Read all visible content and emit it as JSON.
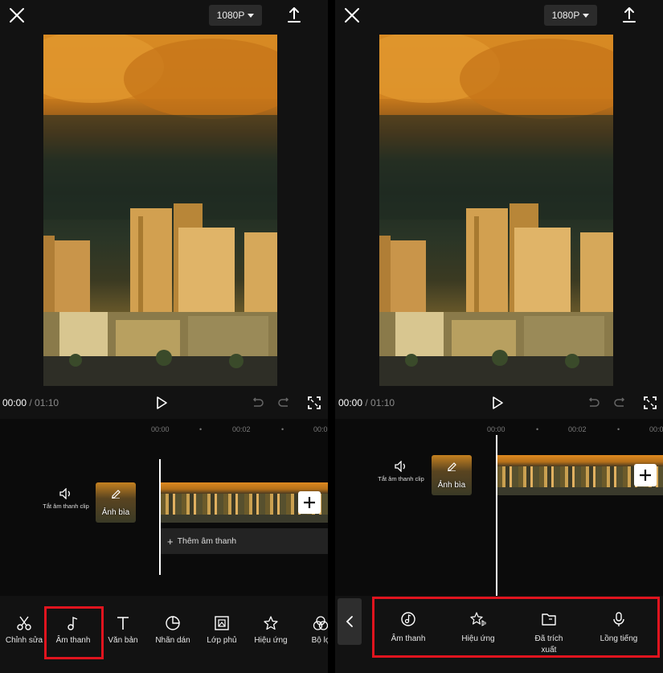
{
  "left": {
    "resolution": "1080P",
    "time_current": "00:00",
    "time_total": "01:10",
    "ruler": [
      "00:00",
      "00:02",
      "00:0"
    ],
    "mute_label": "Tắt âm thanh clip",
    "cover_label": "Ảnh bìa",
    "add_audio_label": "Thêm âm thanh",
    "tools": [
      {
        "label": "Chỉnh sửa",
        "icon": "scissors-icon"
      },
      {
        "label": "Âm thanh",
        "icon": "music-note-icon"
      },
      {
        "label": "Văn bản",
        "icon": "text-icon"
      },
      {
        "label": "Nhãn dán",
        "icon": "sticker-icon"
      },
      {
        "label": "Lớp phủ",
        "icon": "overlay-icon"
      },
      {
        "label": "Hiệu ứng",
        "icon": "effects-star-icon"
      },
      {
        "label": "Bộ lọ",
        "icon": "filter-icon"
      }
    ]
  },
  "right": {
    "resolution": "1080P",
    "time_current": "00:00",
    "time_total": "01:10",
    "ruler": [
      "00:00",
      "00:02",
      "00:0"
    ],
    "mute_label": "Tắt âm thanh clip",
    "cover_label": "Ảnh bìa",
    "subtools": [
      {
        "label": "Âm thanh",
        "icon": "music-disc-icon"
      },
      {
        "label": "Hiệu ứng",
        "icon": "sound-effects-icon"
      },
      {
        "label": "Đã trích xuất",
        "icon": "folder-icon"
      },
      {
        "label": "Lồng tiếng",
        "icon": "microphone-icon"
      }
    ]
  },
  "colors": {
    "background": "#121212",
    "highlight": "#e0141e",
    "chip": "#2b2b2b"
  }
}
